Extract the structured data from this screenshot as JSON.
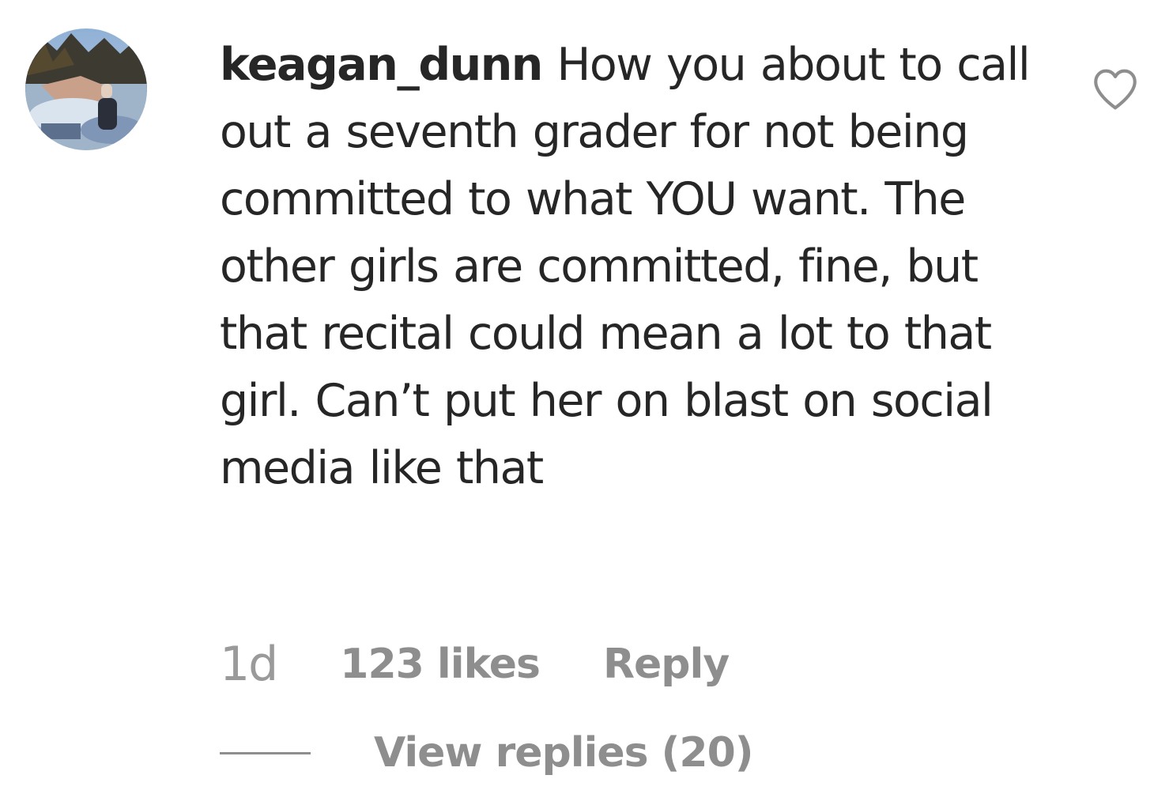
{
  "comment": {
    "username": "keagan_dunn",
    "text": "How you about to call out a seventh grader for not being committed to what YOU want. The other girls are committed, fine, but that recital could mean a lot to that girl. Can’t put her on blast on social media like that",
    "time": "1d",
    "likes": "123 likes",
    "reply_label": "Reply",
    "view_replies_label": "View replies (20)",
    "avatar_icon": "profile-photo",
    "like_icon": "heart-outline-icon"
  },
  "colors": {
    "text_primary": "#262626",
    "text_secondary": "#8e8e8e",
    "background": "#ffffff"
  }
}
